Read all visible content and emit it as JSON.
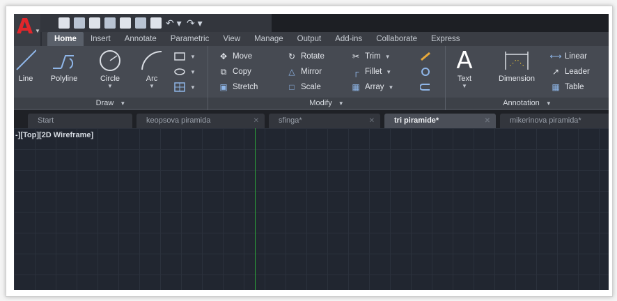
{
  "app": {
    "logo_letter": "A",
    "brand_color": "#e1262b"
  },
  "quick_access": {
    "icons": [
      "new-icon",
      "open-icon",
      "save-icon",
      "save-as-icon",
      "cloud-icon",
      "web-icon",
      "plot-icon",
      "undo-icon",
      "redo-icon"
    ]
  },
  "ribbon_tabs": [
    "Home",
    "Insert",
    "Annotate",
    "Parametric",
    "View",
    "Manage",
    "Output",
    "Add-ins",
    "Collaborate",
    "Express"
  ],
  "active_ribbon_tab": "Home",
  "panels": {
    "draw": {
      "title": "Draw",
      "line": "Line",
      "polyline": "Polyline",
      "circle": "Circle",
      "arc": "Arc"
    },
    "modify": {
      "title": "Modify",
      "move": "Move",
      "rotate": "Rotate",
      "trim": "Trim",
      "copy": "Copy",
      "mirror": "Mirror",
      "fillet": "Fillet",
      "stretch": "Stretch",
      "scale": "Scale",
      "array": "Array"
    },
    "annotation": {
      "title": "Annotation",
      "text": "Text",
      "dimension": "Dimension",
      "linear": "Linear",
      "leader": "Leader",
      "table": "Table"
    }
  },
  "doc_tabs": [
    {
      "label": "Start"
    },
    {
      "label": "keopsova piramida"
    },
    {
      "label": "sfinga*"
    },
    {
      "label": "tri piramide*"
    },
    {
      "label": "mikerinova piramida*"
    }
  ],
  "active_doc_tab": "tri piramide*",
  "viewport": {
    "label": "-][Top][2D Wireframe]"
  },
  "colors": {
    "canvas": "#212630",
    "grid": "#2b313c",
    "y_axis": "#2ca33a"
  }
}
